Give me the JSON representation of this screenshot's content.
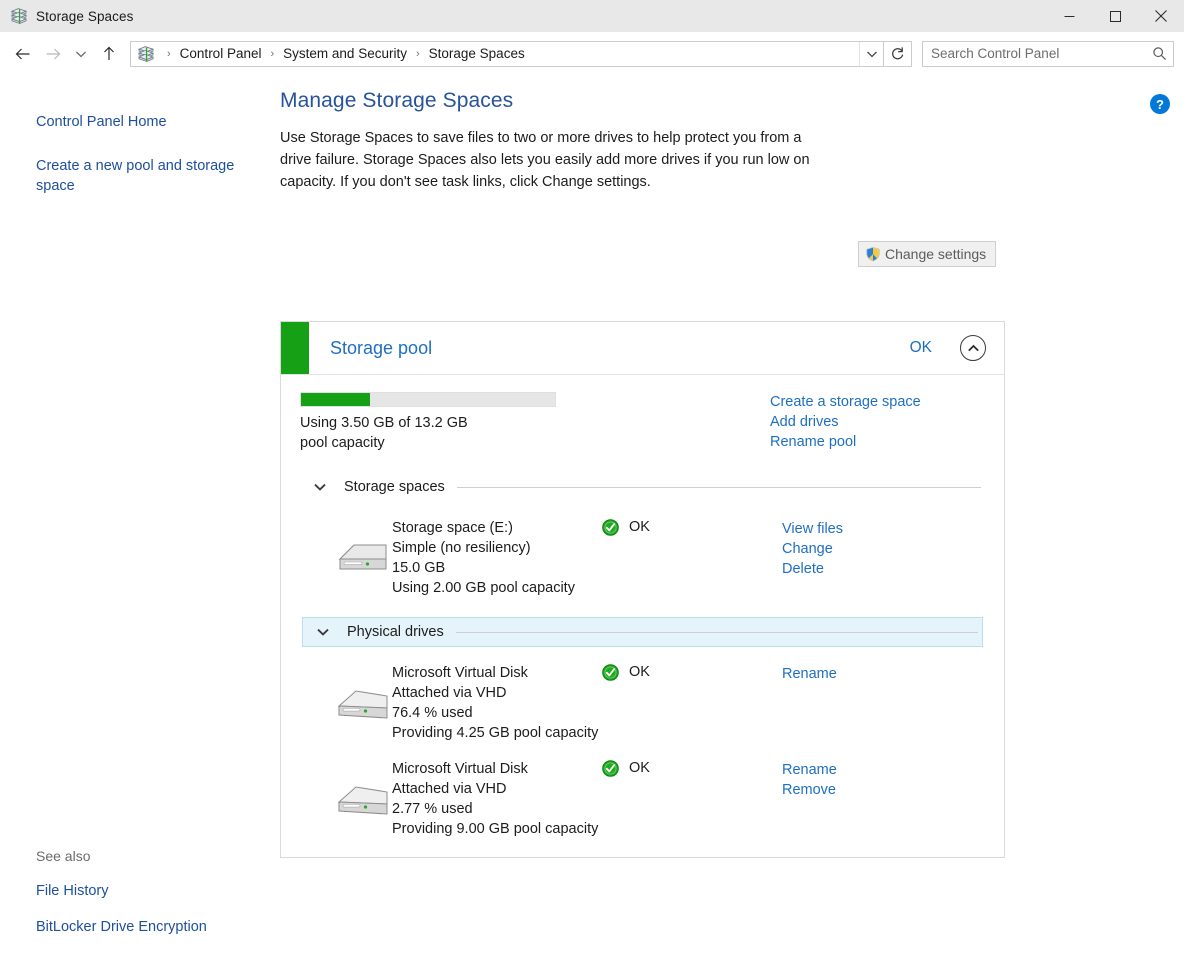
{
  "window": {
    "title": "Storage Spaces",
    "icon": "storage-spaces-icon",
    "minimize_label": "─",
    "maximize_label": "☐",
    "close_label": "✕"
  },
  "nav": {
    "back_label": "←",
    "forward_label": "→",
    "recent_label": "⌄",
    "up_label": "↑",
    "breadcrumbs": [
      "Control Panel",
      "System and Security",
      "Storage Spaces"
    ],
    "separator": "›",
    "dropdown_label": "⌄",
    "refresh_label": "↻"
  },
  "search": {
    "placeholder": "Search Control Panel",
    "value": "",
    "icon": "search-icon"
  },
  "help": {
    "label": "?"
  },
  "sidebar": {
    "links": [
      "Control Panel Home",
      "Create a new pool and storage space"
    ],
    "see_also_title": "See also",
    "see_also_links": [
      "File History",
      "BitLocker Drive Encryption"
    ]
  },
  "main": {
    "page_title": "Manage Storage Spaces",
    "intro": "Use Storage Spaces to save files to two or more drives to help protect you from a drive failure. Storage Spaces also lets you easily add more drives if you run low on capacity. If you don't see task links, click Change settings.",
    "change_settings_label": "Change settings"
  },
  "pool": {
    "title": "Storage pool",
    "status": "OK",
    "status_color": "#16a016",
    "collapse_icon": "chevron-up-icon",
    "usage_percent": 27,
    "usage_text": "Using 3.50 GB of 13.2 GB pool capacity",
    "links": [
      "Create a storage space",
      "Add drives",
      "Rename pool"
    ]
  },
  "storage_spaces_section": {
    "label": "Storage spaces",
    "chevron": "chevron-down-icon",
    "items": [
      {
        "name": "Storage space (E:)",
        "resiliency": "Simple (no resiliency)",
        "size": "15.0 GB",
        "usage": "Using 2.00 GB pool capacity",
        "status": "OK",
        "links": [
          "View files",
          "Change",
          "Delete"
        ]
      }
    ]
  },
  "physical_drives_section": {
    "label": "Physical drives",
    "chevron": "chevron-down-icon",
    "highlighted": true,
    "items": [
      {
        "name": "Microsoft Virtual Disk",
        "attachment": "Attached via VHD",
        "used": "76.4 % used",
        "providing": "Providing 4.25 GB pool capacity",
        "status": "OK",
        "links": [
          "Rename"
        ]
      },
      {
        "name": "Microsoft Virtual Disk",
        "attachment": "Attached via VHD",
        "used": "2.77 % used",
        "providing": "Providing 9.00 GB pool capacity",
        "status": "OK",
        "links": [
          "Rename",
          "Remove"
        ]
      }
    ]
  }
}
